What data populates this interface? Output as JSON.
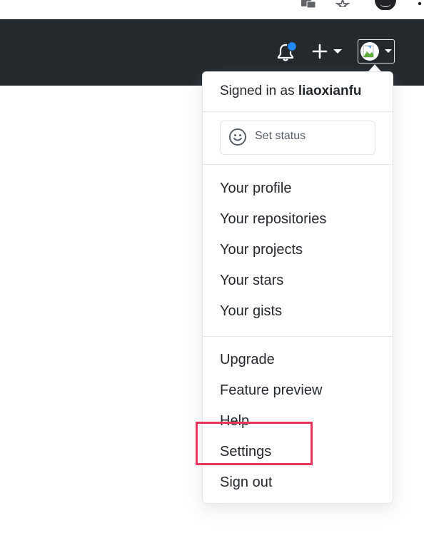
{
  "browser": {
    "icons": [
      "translate-icon",
      "star-icon",
      "profile-icon",
      "more-icon"
    ]
  },
  "header": {
    "icons": [
      "bell-icon",
      "plus-icon",
      "avatar"
    ],
    "notification_color": "#2188ff",
    "background": "#24292e"
  },
  "dropdown": {
    "signed_in_prefix": "Signed in as",
    "username": "liaoxianfu",
    "set_status_label": "Set status",
    "profile_items": [
      "Your profile",
      "Your repositories",
      "Your projects",
      "Your stars",
      "Your gists"
    ],
    "account_items": [
      "Upgrade",
      "Feature preview",
      "Help",
      "Settings",
      "Sign out"
    ]
  },
  "annotation": {
    "highlight_color": "#e8355a",
    "highlighted_item": "Settings"
  }
}
